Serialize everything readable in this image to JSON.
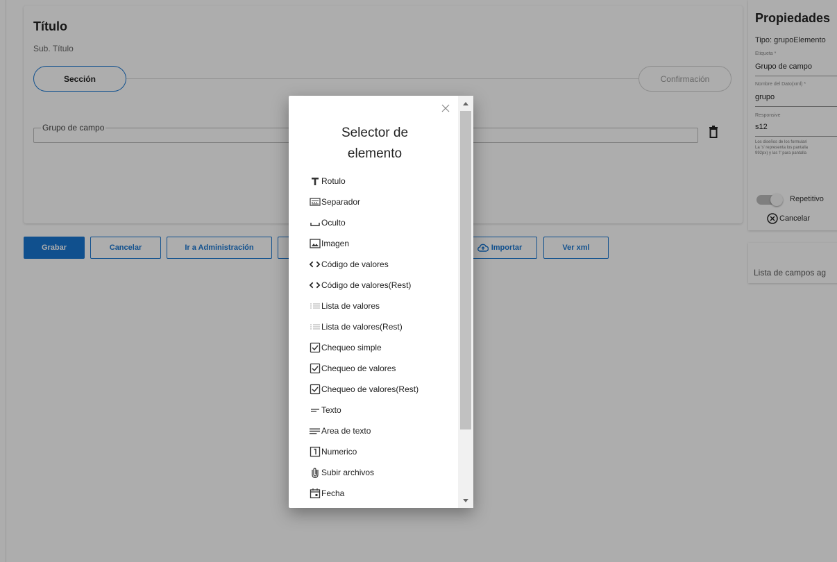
{
  "form": {
    "title": "Título",
    "subtitle": "Sub. Título",
    "steps": [
      "Sección",
      "Confirmación"
    ],
    "group_legend": "Grupo de campo"
  },
  "buttons": {
    "save": "Grabar",
    "cancel": "Cancelar",
    "admin": "Ir a Administración",
    "import": "Importar",
    "view_xml": "Ver xml"
  },
  "properties": {
    "title": "Propiedades",
    "tipo": "Tipo: grupoElemento",
    "etiqueta_label": "Etiqueta *",
    "etiqueta_value": "Grupo de campo",
    "nombre_label": "Nombre del Dato(xml) *",
    "nombre_value": "grupo",
    "responsive_label": "Responsive",
    "responsive_value": "s12",
    "note_line1": "Los diseños de los formulari",
    "note_line2": "La 's' representa los pantalla",
    "note_line3": "992px) y las 'l' para pantalla",
    "repetitivo_label": "Repetitivo",
    "cancel_label": "Cancelar",
    "campos_label": "Lista de campos ag"
  },
  "modal": {
    "title_line1": "Selector de",
    "title_line2": "elemento",
    "items": [
      {
        "label": "Rotulo",
        "icon": "text-format-icon"
      },
      {
        "label": "Separador",
        "icon": "separator-icon"
      },
      {
        "label": "Oculto",
        "icon": "space-bar-icon"
      },
      {
        "label": "Imagen",
        "icon": "image-icon"
      },
      {
        "label": "Código de valores",
        "icon": "code-icon"
      },
      {
        "label": "Código de valores(Rest)",
        "icon": "code-icon"
      },
      {
        "label": "Lista de valores",
        "icon": "list-icon"
      },
      {
        "label": "Lista de valores(Rest)",
        "icon": "list-icon"
      },
      {
        "label": "Chequeo simple",
        "icon": "checkbox-icon"
      },
      {
        "label": "Chequeo de valores",
        "icon": "checkbox-icon"
      },
      {
        "label": "Chequeo de valores(Rest)",
        "icon": "checkbox-icon"
      },
      {
        "label": "Texto",
        "icon": "short-text-icon"
      },
      {
        "label": "Area de texto",
        "icon": "notes-icon"
      },
      {
        "label": "Numerico",
        "icon": "number-box-icon"
      },
      {
        "label": "Subir archivos",
        "icon": "attach-file-icon"
      },
      {
        "label": "Fecha",
        "icon": "calendar-icon"
      }
    ]
  },
  "colors": {
    "primary": "#1976d2",
    "overlay": "rgba(0,0,0,0.32)"
  }
}
